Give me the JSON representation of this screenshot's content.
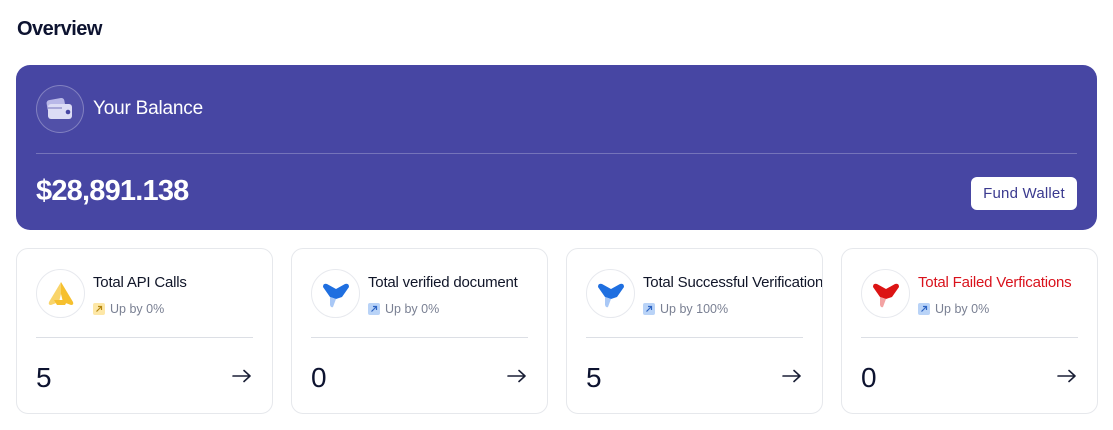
{
  "page": {
    "title": "Overview"
  },
  "balance": {
    "label": "Your Balance",
    "amount": "$28,891.138",
    "fund_button_label": "Fund Wallet",
    "icon": "wallet-icon",
    "background_color": "#4746a3"
  },
  "stats": [
    {
      "title": "Total API Calls",
      "trend": "Up by 0%",
      "value": "5",
      "icon": "api-calls-icon",
      "icon_color": "#f6c02e",
      "trend_color": "yellow",
      "title_color": "#101528"
    },
    {
      "title": "Total verified document",
      "trend": "Up by 0%",
      "value": "0",
      "icon": "verified-document-icon",
      "icon_color": "#1f6fe0",
      "trend_color": "blue",
      "title_color": "#101528"
    },
    {
      "title": "Total Successful Verifications",
      "trend": "Up by 100%",
      "value": "5",
      "icon": "successful-verification-icon",
      "icon_color": "#1f6fe0",
      "trend_color": "blue",
      "title_color": "#101528"
    },
    {
      "title": "Total Failed Verfications",
      "trend": "Up by 0%",
      "value": "0",
      "icon": "failed-verification-icon",
      "icon_color": "#dc1414",
      "trend_color": "blue",
      "title_color": "#d9121c"
    }
  ]
}
